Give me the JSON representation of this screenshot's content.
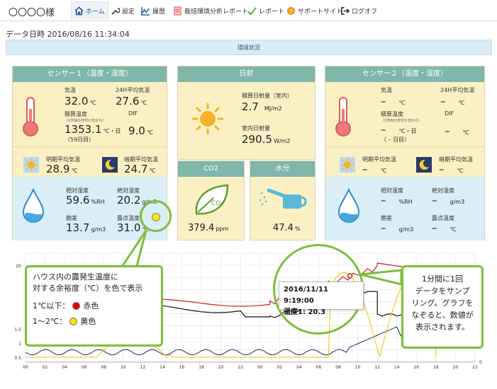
{
  "nav": {
    "brand": "〇〇〇〇様",
    "items": [
      {
        "label": "ホーム",
        "icon": "home-icon"
      },
      {
        "label": "設定",
        "icon": "wrench-icon"
      },
      {
        "label": "履歴",
        "icon": "chart-line-icon"
      },
      {
        "label": "栽培環境分析レポート",
        "icon": "document-icon"
      },
      {
        "label": "レポート",
        "icon": "check-icon"
      },
      {
        "label": "サポートサイト",
        "icon": "help-icon"
      },
      {
        "label": "ログオフ",
        "icon": "logout-icon"
      }
    ]
  },
  "header": {
    "datetime_label": "データ日時",
    "datetime_value": "2016/08/16 11:34:04",
    "banner": "環境状況"
  },
  "sensor1": {
    "title": "センサー１（温度・湿度）",
    "temp_label": "気温",
    "temp_value": "32.0",
    "temp_unit": "℃",
    "avg24_label": "24H平均気温",
    "avg24_value": "27.6",
    "avg24_unit": "℃",
    "cum_label": "積算温度",
    "cum_note": "（1作目の作付け日から）",
    "cum_value": "1353.1",
    "cum_unit": "℃・日",
    "cum_days": "（59日目）",
    "dif_label": "DIF",
    "dif_value": "9.0",
    "dif_unit": "℃",
    "day_label": "明期平均気温",
    "day_value": "28.9",
    "day_unit": "℃",
    "night_label": "暗期平均気温",
    "night_value": "24.7",
    "night_unit": "℃",
    "rh_label": "相対湿度",
    "rh_value": "59.6",
    "rh_unit": "%RH",
    "ah_label": "絶対湿度",
    "ah_value": "20.2",
    "ah_unit": "g/m3",
    "def_label": "飽差",
    "def_value": "13.7",
    "def_unit": "g/m3",
    "dew_label": "露点温度",
    "dew_value": "31.0",
    "dew_unit": "℃"
  },
  "solar": {
    "title": "日射",
    "cum_label": "積算日射量（室内）",
    "cum_value": "2.7",
    "cum_unit": "MJ/m2",
    "indoor_label": "室内日射量",
    "indoor_value": "290.5",
    "indoor_unit": "W/m2"
  },
  "co2": {
    "title": "CO2",
    "value": "379.4",
    "unit": "ppm",
    "leaf_text": "CO₂"
  },
  "water": {
    "title": "水分",
    "value": "47.4",
    "unit": "%"
  },
  "sensor2": {
    "title": "センサー２（温度・湿度）",
    "temp_label": "気温",
    "temp_value": "–",
    "temp_unit": "℃",
    "avg24_label": "24H平均気温",
    "avg24_value": "–",
    "avg24_unit": "℃",
    "cum_label": "積算温度",
    "cum_note": "（1作目の作付け日から）",
    "cum_value": "–",
    "cum_unit": "℃・日",
    "cum_days": "（ – 日目）",
    "dif_label": "DIF",
    "dif_value": "–",
    "dif_unit": "℃",
    "day_label": "明期平均気温",
    "day_value": "–",
    "day_unit": "℃",
    "night_label": "暗期平均気温",
    "night_value": "–",
    "night_unit": "℃",
    "rh_label": "相対湿度",
    "rh_value": "–",
    "rh_unit": "%RH",
    "ah_label": "絶対湿度",
    "ah_value": "–",
    "ah_unit": "g/m3",
    "def_label": "飽差",
    "def_value": "–",
    "def_unit": "g/m3",
    "dew_label": "露点温度",
    "dew_value": "–",
    "dew_unit": "℃"
  },
  "callout_left": {
    "line1": "ハウス内の露発生温度に",
    "line2": "対する余裕度（℃）を色で表示",
    "leg1_text": "1℃以下：",
    "leg1_color_name": "赤色",
    "leg1_color": "#e00000",
    "leg2_text": "1～2℃：",
    "leg2_color_name": "黄色",
    "leg2_color": "#ffe600"
  },
  "callout_right": {
    "line1": "1分間に1回",
    "line2": "データをサンプ",
    "line3": "リング。グラフを",
    "line4": "なぞると、数値が",
    "line5": "表示されます。"
  },
  "tooltip": {
    "datetime": "2016/11/11 9:19:00",
    "label": "温度1:",
    "value": "20.3"
  },
  "chart_data": {
    "type": "line",
    "x_ticks": [
      "00",
      "02",
      "04",
      "06",
      "08",
      "10",
      "12",
      "14",
      "16",
      "18",
      "20",
      "22",
      "00",
      "02",
      "04",
      "06",
      "08",
      "10",
      "12",
      "14",
      "16",
      "18",
      "20",
      "22"
    ],
    "y_ticks_left": [
      "20",
      "1.5",
      "1",
      "0.5"
    ],
    "y_ticks_right": [
      "0"
    ],
    "series": [
      {
        "color": "#cc2020",
        "values": []
      },
      {
        "color": "#111111",
        "values": []
      },
      {
        "color": "#f2c200",
        "values": []
      },
      {
        "color": "#1a2a6c",
        "values": []
      }
    ]
  }
}
